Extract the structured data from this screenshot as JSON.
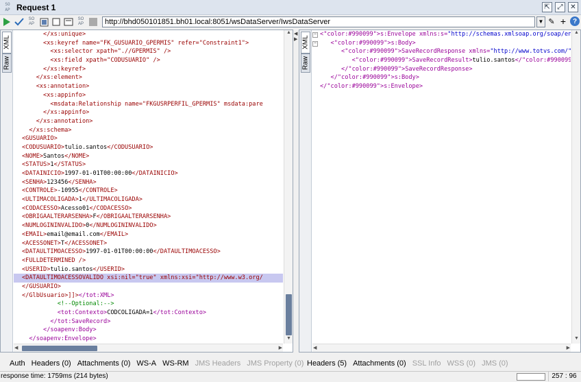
{
  "window": {
    "logo": "SOAP",
    "title": "Request 1"
  },
  "toolbar": {
    "url": "http://bhd050101851.bh01.local:8051/wsDataServer/IwsDataServer"
  },
  "left": {
    "tabs": [
      "XML",
      "Raw"
    ],
    "lines": [
      {
        "t": "      </xs:unique>",
        "hl": false
      },
      {
        "t": "      <xs:keyref name=\"FK_GUSUARIO_GPERMIS\" refer=\"Constraint1\">",
        "hl": false
      },
      {
        "t": "        <xs:selector xpath=\".//GPERMIS\" />",
        "hl": false
      },
      {
        "t": "        <xs:field xpath=\"CODUSUARIO\" />",
        "hl": false
      },
      {
        "t": "      </xs:keyref>",
        "hl": false
      },
      {
        "t": "    </xs:element>",
        "hl": false
      },
      {
        "t": "    <xs:annotation>",
        "hl": false
      },
      {
        "t": "      <xs:appinfo>",
        "hl": false
      },
      {
        "t": "        <msdata:Relationship name=\"FKGUSRPERFIL_GPERMIS\" msdata:pare",
        "hl": false
      },
      {
        "t": "      </xs:appinfo>",
        "hl": false
      },
      {
        "t": "    </xs:annotation>",
        "hl": false
      },
      {
        "t": "  </xs:schema>",
        "hl": false
      },
      {
        "t": "<GUSUARIO>",
        "hl": false
      },
      {
        "t": "<CODUSUARIO>tulio.santos</CODUSUARIO>",
        "hl": false
      },
      {
        "t": "<NOME>Santos</NOME>",
        "hl": false
      },
      {
        "t": "<STATUS>1</STATUS>",
        "hl": false
      },
      {
        "t": "<DATAINICIO>1997-01-01T00:00:00</DATAINICIO>",
        "hl": false
      },
      {
        "t": "<SENHA>123456</SENHA>",
        "hl": false
      },
      {
        "t": "<CONTROLE>-10955</CONTROLE>",
        "hl": false
      },
      {
        "t": "<ULTIMACOLIGADA>1</ULTIMACOLIGADA>",
        "hl": false
      },
      {
        "t": "<CODACESSO>Acesso01</CODACESSO>",
        "hl": false
      },
      {
        "t": "<OBRIGAALTERARSENHA>F</OBRIGAALTERARSENHA>",
        "hl": false
      },
      {
        "t": "<NUMLOGININVALIDO>0</NUMLOGININVALIDO>",
        "hl": false
      },
      {
        "t": "<EMAIL>email@email.com</EMAIL>",
        "hl": false
      },
      {
        "t": "<ACESSONET>T</ACESSONET>",
        "hl": false
      },
      {
        "t": "<DATAULTIMOACESSO>1997-01-01T00:00:00</DATAULTIMOACESSO>",
        "hl": false
      },
      {
        "t": "<FULLDETERMINED />",
        "hl": false
      },
      {
        "t": "<USERID>tulio.santos</USERID>",
        "hl": false
      },
      {
        "t": "<DATAULTIMOACESSOVALIDO xsi:nil=\"true\" xmlns:xsi=\"http://www.w3.org/",
        "hl": true
      },
      {
        "t": "</GUSUARIO>",
        "hl": false
      },
      {
        "t": "</GlbUsuario>]]></tot:XML>",
        "hl": false
      },
      {
        "t": "          <!--Optional:-->",
        "hl": false,
        "c": true
      },
      {
        "t": "          <tot:Contexto>CODCOLIGADA=1</tot:Contexto>",
        "hl": false
      },
      {
        "t": "        </tot:SaveRecord>",
        "hl": false
      },
      {
        "t": "      </soapenv:Body>",
        "hl": false
      },
      {
        "t": "  </soapenv:Envelope>",
        "hl": false
      }
    ],
    "bottom_tabs": [
      {
        "label": "Auth",
        "dis": false
      },
      {
        "label": "Headers (0)",
        "dis": false
      },
      {
        "label": "Attachments (0)",
        "dis": false
      },
      {
        "label": "WS-A",
        "dis": false
      },
      {
        "label": "WS-RM",
        "dis": false
      },
      {
        "label": "JMS Headers",
        "dis": true
      },
      {
        "label": "JMS Property (0)",
        "dis": true
      }
    ]
  },
  "right": {
    "tabs": [
      "XML",
      "Raw"
    ],
    "lines": [
      {
        "t": "<s:Envelope xmlns:s=\"http://schemas.xmlsoap.org/soap/envelope/\">"
      },
      {
        "t": "   <s:Body>"
      },
      {
        "t": "      <SaveRecordResponse xmlns=\"http://www.totvs.com/\">"
      },
      {
        "t": "         <SaveRecordResult>tulio.santos</SaveRecordResult>"
      },
      {
        "t": "      </SaveRecordResponse>"
      },
      {
        "t": "   </s:Body>"
      },
      {
        "t": "</s:Envelope>"
      }
    ],
    "bottom_tabs": [
      {
        "label": "Headers (5)",
        "dis": false
      },
      {
        "label": "Attachments (0)",
        "dis": false
      },
      {
        "label": "SSL Info",
        "dis": true
      },
      {
        "label": "WSS (0)",
        "dis": true
      },
      {
        "label": "JMS (0)",
        "dis": true
      }
    ]
  },
  "status": {
    "text": "response time: 1759ms (214 bytes)",
    "position": "257 : 96"
  }
}
